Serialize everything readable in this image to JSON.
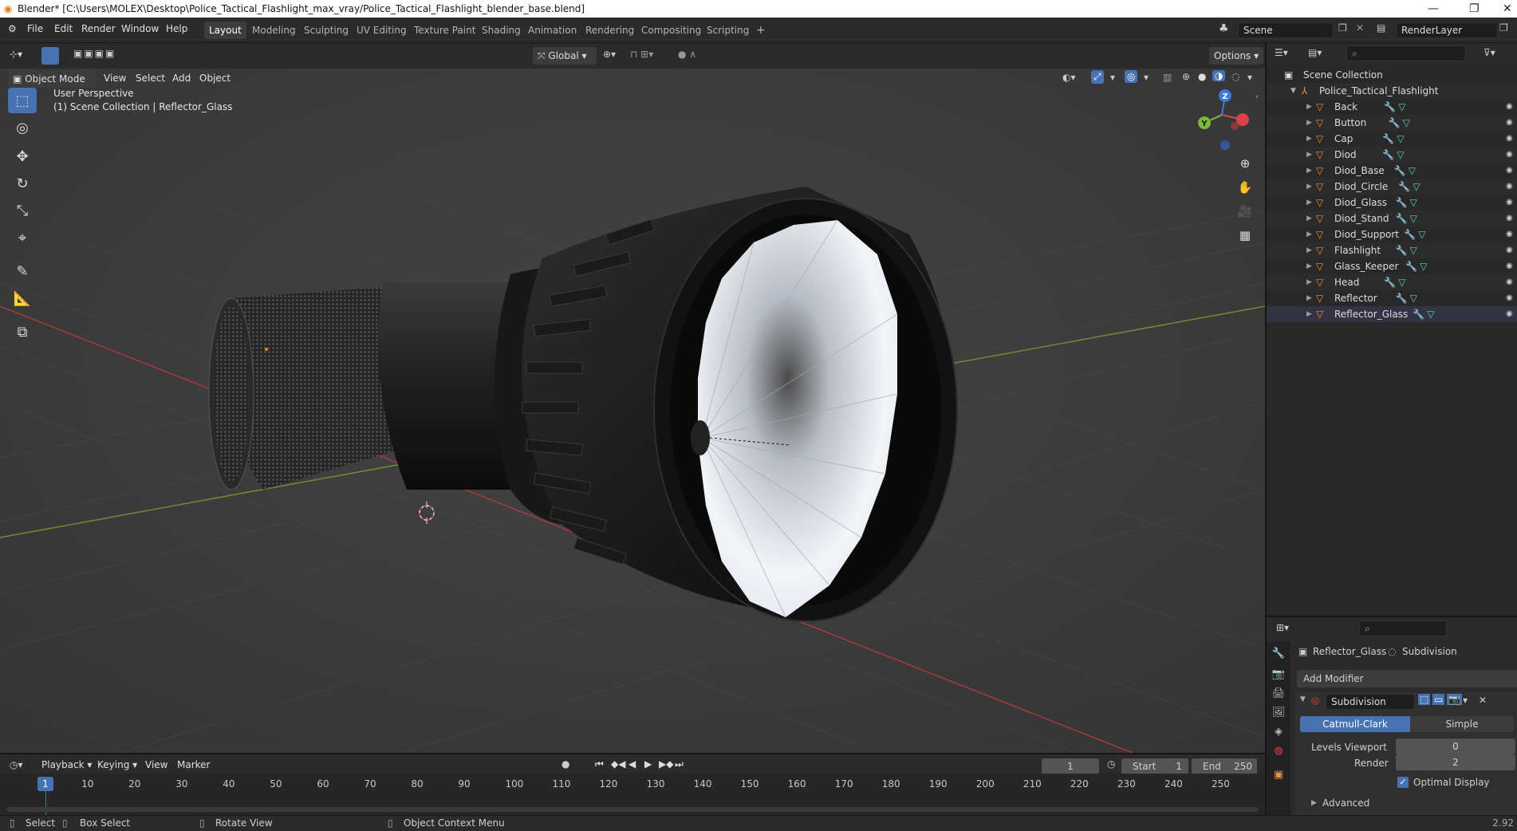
{
  "window": {
    "title": "Blender* [C:\\Users\\MOLEX\\Desktop\\Police_Tactical_Flashlight_max_vray/Police_Tactical_Flashlight_blender_base.blend]"
  },
  "menu": [
    "File",
    "Edit",
    "Render",
    "Window",
    "Help"
  ],
  "workspaces": [
    "Layout",
    "Modeling",
    "Sculpting",
    "UV Editing",
    "Texture Paint",
    "Shading",
    "Animation",
    "Rendering",
    "Compositing",
    "Scripting"
  ],
  "active_workspace": "Layout",
  "scene": {
    "name": "Scene",
    "render_layer": "RenderLayer"
  },
  "viewport_header": {
    "mode": "Object Mode",
    "menus": [
      "View",
      "Select",
      "Add",
      "Object"
    ],
    "transform_orientation": "Global",
    "options_label": "Options"
  },
  "viewport": {
    "perspective": "User Perspective",
    "collection_info": "(1) Scene Collection | Reflector_Glass",
    "gizmo_labels": {
      "z": "Z",
      "y": "Y"
    }
  },
  "outliner": {
    "root": "Scene Collection",
    "collection": "Police_Tactical_Flashlight",
    "objects": [
      "Back",
      "Button",
      "Cap",
      "Diod",
      "Diod_Base",
      "Diod_Circle",
      "Diod_Glass",
      "Diod_Stand",
      "Diod_Support",
      "Flashlight",
      "Glass_Keeper",
      "Head",
      "Reflector",
      "Reflector_Glass"
    ],
    "active_object": "Reflector_Glass"
  },
  "properties": {
    "object_name": "Reflector_Glass",
    "modifier_breadcrumb": "Subdivision",
    "add_modifier_label": "Add Modifier",
    "modifier_name": "Subdivision",
    "method_options": [
      "Catmull-Clark",
      "Simple"
    ],
    "active_method": "Catmull-Clark",
    "levels_viewport_label": "Levels Viewport",
    "levels_viewport": "0",
    "render_label": "Render",
    "render_level": "2",
    "optimal_display_label": "Optimal Display",
    "advanced_label": "Advanced"
  },
  "timeline": {
    "menus": [
      "Playback",
      "Keying",
      "View",
      "Marker"
    ],
    "current_frame": "1",
    "start_label": "Start",
    "start": "1",
    "end_label": "End",
    "end": "250",
    "ticks": [
      "10",
      "20",
      "30",
      "40",
      "50",
      "60",
      "70",
      "80",
      "90",
      "100",
      "110",
      "120",
      "130",
      "140",
      "150",
      "160",
      "170",
      "180",
      "190",
      "200",
      "210",
      "220",
      "230",
      "240",
      "250"
    ],
    "playhead": "1"
  },
  "statusbar": {
    "select": "Select",
    "box_select": "Box Select",
    "rotate_view": "Rotate View",
    "context_menu": "Object Context Menu",
    "version": "2.92"
  },
  "colors": {
    "accent": "#4772b3",
    "object_orange": "#e8954a",
    "x_axis": "#d8424a",
    "y_axis": "#7cb93b",
    "z_axis": "#3e7ad8"
  }
}
